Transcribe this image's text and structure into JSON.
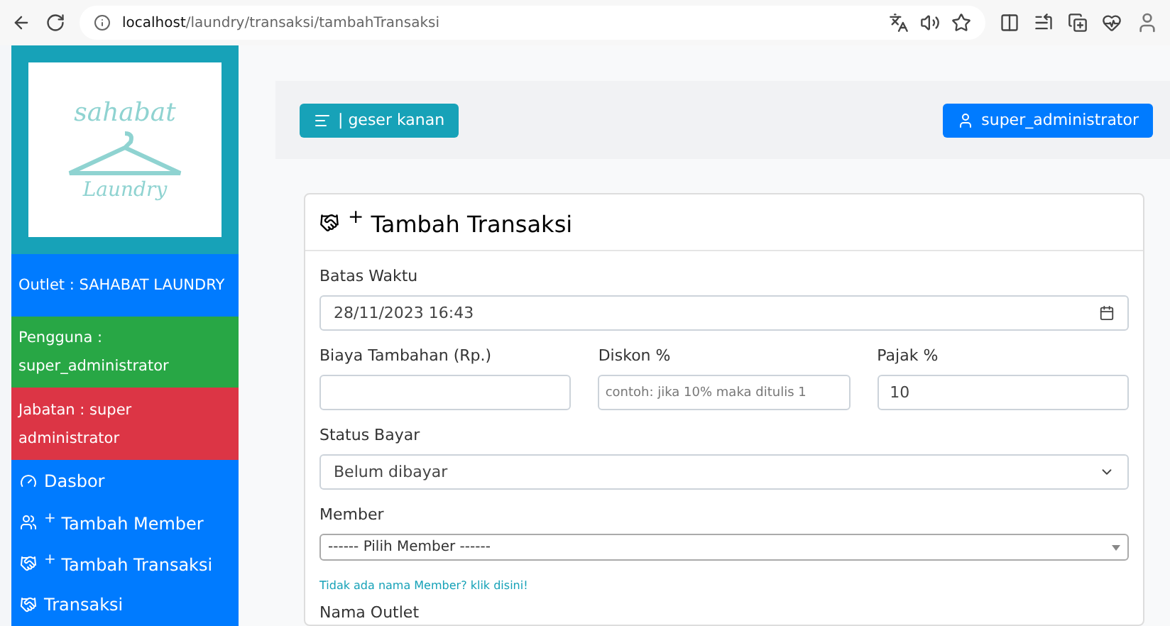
{
  "browser": {
    "url_host": "localhost",
    "url_path": "/laundry/transaksi/tambahTransaksi"
  },
  "sidebar": {
    "logo": {
      "top": "sahabat",
      "bottom": "Laundry"
    },
    "info": [
      {
        "text": "Outlet : SAHABAT LAUNDRY",
        "color": "#007bff"
      },
      {
        "text": "Pengguna : super_administrator",
        "color": "#28a745"
      },
      {
        "text": "Jabatan : super administrator",
        "color": "#dc3545"
      }
    ],
    "items": [
      {
        "label": "Dasbor",
        "kind": "dashboard"
      },
      {
        "label": "$^{+}$ Tambah Member",
        "kind": "member"
      },
      {
        "label": "$^{+}$ Tambah Transaksi",
        "kind": "transaction"
      },
      {
        "label": "Transaksi",
        "kind": "transaction"
      }
    ]
  },
  "topbar": {
    "toggle": "| geser kanan",
    "user": "super_administrator"
  },
  "card": {
    "title": "$^{+}$ Tambah Transaksi",
    "deadline": {
      "label": "Batas Waktu",
      "value": "28/11/2023 16:43"
    },
    "extra": {
      "label": "Biaya Tambahan (Rp.)"
    },
    "discount": {
      "label": "Diskon %",
      "placeholder": "contoh: jika 10% maka ditulis 1"
    },
    "tax": {
      "label": "Pajak %",
      "value": "10"
    },
    "status": {
      "label": "Status Bayar",
      "value": "Belum dibayar"
    },
    "member": {
      "label": "Member",
      "value": "------ Pilih Member ------",
      "hint": "Tidak ada nama Member? klik disini!"
    },
    "outlet": {
      "label": "Nama Outlet"
    }
  }
}
